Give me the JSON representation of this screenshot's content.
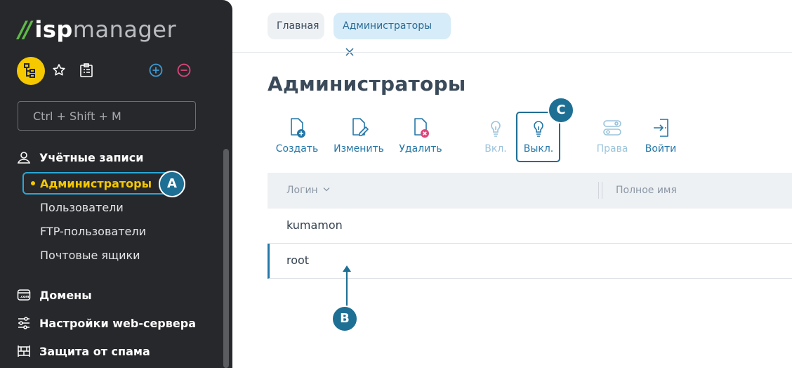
{
  "app": {
    "logo_brand": "ispmanager",
    "logo_isp": "isp",
    "logo_manager": "manager"
  },
  "sidebar": {
    "search_placeholder": "Ctrl + Shift + M",
    "sections": [
      {
        "label": "Учётные записи",
        "icon": "user-location-icon"
      },
      {
        "label": "Домены",
        "icon": "domain-icon"
      },
      {
        "label": "Настройки web-сервера",
        "icon": "sliders-icon"
      },
      {
        "label": "Защита от спама",
        "icon": "firewall-icon"
      }
    ],
    "accounts_items": [
      "Администраторы",
      "Пользователи",
      "FTP-пользователи",
      "Почтовые ящики"
    ],
    "active_item": "Администраторы"
  },
  "breadcrumbs": [
    {
      "label": "Главная"
    },
    {
      "label": "Администраторы",
      "closable": true
    }
  ],
  "page": {
    "title": "Администраторы"
  },
  "toolbar": [
    {
      "label": "Создать",
      "icon": "file-plus-icon",
      "enabled": true
    },
    {
      "label": "Изменить",
      "icon": "file-edit-icon",
      "enabled": true
    },
    {
      "label": "Удалить",
      "icon": "file-delete-icon",
      "enabled": true
    },
    {
      "label": "Вкл.",
      "icon": "bulb-on-icon",
      "enabled": false
    },
    {
      "label": "Выкл.",
      "icon": "bulb-off-icon",
      "enabled": true,
      "highlighted": true
    },
    {
      "label": "Права",
      "icon": "permissions-icon",
      "enabled": false
    },
    {
      "label": "Войти",
      "icon": "login-icon",
      "enabled": true
    }
  ],
  "table": {
    "columns": [
      "Логин",
      "Полное имя"
    ],
    "rows": [
      {
        "login": "kumamon",
        "full_name": ""
      },
      {
        "login": "root",
        "full_name": "",
        "selected": true
      }
    ]
  },
  "annotations": {
    "a": "A",
    "b": "B",
    "c": "C"
  },
  "colors": {
    "sidebar_bg": "#27282b",
    "accent": "#2477a8",
    "active": "#f5c800",
    "marker": "#1e6f94",
    "logo_green": "#5fb94a"
  }
}
